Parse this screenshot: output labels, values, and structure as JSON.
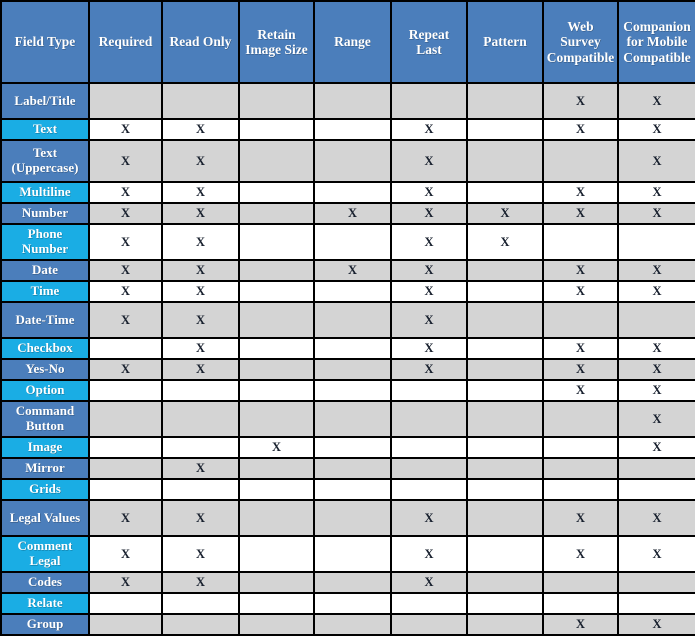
{
  "table": {
    "title_cell": "Field Type",
    "columns": [
      "Field Type",
      "Required",
      "Read Only",
      "Retain Image Size",
      "Range",
      "Repeat Last",
      "Pattern",
      "Web Survey Compatible",
      "Companion for Mobile Compatible"
    ],
    "column_lines": [
      [
        "Field Type"
      ],
      [
        "Required"
      ],
      [
        "Read Only"
      ],
      [
        "Retain",
        "Image Size"
      ],
      [
        "Range"
      ],
      [
        "Repeat",
        "Last"
      ],
      [
        "Pattern"
      ],
      [
        "Web",
        "Survey",
        "Compatible"
      ],
      [
        "Companion",
        "for Mobile",
        "Compatible"
      ]
    ],
    "mark": "X",
    "empty": "",
    "colors": {
      "header_blue": "#4B7EBB",
      "row_label_blue": "#4B7EBB",
      "row_label_cyan": "#1AADE4",
      "cell_gray": "#D4D4D4",
      "cell_white": "#FFFFFF",
      "border": "#000000",
      "header_text": "#FFFFFF",
      "mark_text": "#18202E"
    },
    "rows": [
      {
        "label": "Label/Title",
        "label_lines": [
          "Label/Title"
        ],
        "band": "a",
        "height": "h2",
        "values": [
          "",
          "",
          "",
          "",
          "",
          "",
          "X",
          "X"
        ]
      },
      {
        "label": "Text",
        "label_lines": [
          "Text"
        ],
        "band": "b",
        "height": "h1",
        "values": [
          "X",
          "X",
          "",
          "",
          "X",
          "",
          "X",
          "X"
        ]
      },
      {
        "label": "Text (Uppercase)",
        "label_lines": [
          "Text",
          "(Uppercase)"
        ],
        "band": "a",
        "height": "h3",
        "values": [
          "X",
          "X",
          "",
          "",
          "X",
          "",
          "",
          "X"
        ]
      },
      {
        "label": "Multiline",
        "label_lines": [
          "Multiline"
        ],
        "band": "b",
        "height": "h1",
        "values": [
          "X",
          "X",
          "",
          "",
          "X",
          "",
          "X",
          "X"
        ]
      },
      {
        "label": "Number",
        "label_lines": [
          "Number"
        ],
        "band": "a",
        "height": "h1",
        "values": [
          "X",
          "X",
          "",
          "X",
          "X",
          "X",
          "X",
          "X"
        ]
      },
      {
        "label": "Phone Number",
        "label_lines": [
          "Phone",
          "Number"
        ],
        "band": "b",
        "height": "h2",
        "values": [
          "X",
          "X",
          "",
          "",
          "X",
          "X",
          "",
          ""
        ]
      },
      {
        "label": "Date",
        "label_lines": [
          "Date"
        ],
        "band": "a",
        "height": "h1",
        "values": [
          "X",
          "X",
          "",
          "X",
          "X",
          "",
          "X",
          "X"
        ]
      },
      {
        "label": "Time",
        "label_lines": [
          "Time"
        ],
        "band": "b",
        "height": "h1",
        "values": [
          "X",
          "X",
          "",
          "",
          "X",
          "",
          "X",
          "X"
        ]
      },
      {
        "label": "Date-Time",
        "label_lines": [
          "Date-Time"
        ],
        "band": "a",
        "height": "h2",
        "values": [
          "X",
          "X",
          "",
          "",
          "X",
          "",
          "",
          ""
        ]
      },
      {
        "label": "Checkbox",
        "label_lines": [
          "Checkbox"
        ],
        "band": "b",
        "height": "h1",
        "values": [
          "",
          "X",
          "",
          "",
          "X",
          "",
          "X",
          "X"
        ]
      },
      {
        "label": "Yes-No",
        "label_lines": [
          "Yes-No"
        ],
        "band": "a",
        "height": "h1",
        "values": [
          "X",
          "X",
          "",
          "",
          "X",
          "",
          "X",
          "X"
        ]
      },
      {
        "label": "Option",
        "label_lines": [
          "Option"
        ],
        "band": "b",
        "height": "h1",
        "values": [
          "",
          "",
          "",
          "",
          "",
          "",
          "X",
          "X"
        ]
      },
      {
        "label": "Command Button",
        "label_lines": [
          "Command",
          "Button"
        ],
        "band": "a",
        "height": "h2",
        "values": [
          "",
          "",
          "",
          "",
          "",
          "",
          "",
          "X"
        ]
      },
      {
        "label": "Image",
        "label_lines": [
          "Image"
        ],
        "band": "b",
        "height": "h1",
        "values": [
          "",
          "",
          "X",
          "",
          "",
          "",
          "",
          "X"
        ]
      },
      {
        "label": "Mirror",
        "label_lines": [
          "Mirror"
        ],
        "band": "a",
        "height": "h1",
        "values": [
          "",
          "X",
          "",
          "",
          "",
          "",
          "",
          ""
        ]
      },
      {
        "label": "Grids",
        "label_lines": [
          "Grids"
        ],
        "band": "b",
        "height": "h1",
        "values": [
          "",
          "",
          "",
          "",
          "",
          "",
          "",
          ""
        ]
      },
      {
        "label": "Legal Values",
        "label_lines": [
          "Legal Values"
        ],
        "band": "a",
        "height": "h2",
        "values": [
          "X",
          "X",
          "",
          "",
          "X",
          "",
          "X",
          "X"
        ]
      },
      {
        "label": "Comment Legal",
        "label_lines": [
          "Comment",
          "Legal"
        ],
        "band": "b",
        "height": "h2",
        "values": [
          "X",
          "X",
          "",
          "",
          "X",
          "",
          "X",
          "X"
        ]
      },
      {
        "label": "Codes",
        "label_lines": [
          "Codes"
        ],
        "band": "a",
        "height": "h1",
        "values": [
          "X",
          "X",
          "",
          "",
          "X",
          "",
          "",
          ""
        ]
      },
      {
        "label": "Relate",
        "label_lines": [
          "Relate"
        ],
        "band": "b",
        "height": "h1",
        "values": [
          "",
          "",
          "",
          "",
          "",
          "",
          "",
          ""
        ]
      },
      {
        "label": "Group",
        "label_lines": [
          "Group"
        ],
        "band": "a",
        "height": "h1",
        "values": [
          "",
          "",
          "",
          "",
          "",
          "",
          "X",
          "X"
        ]
      }
    ]
  }
}
